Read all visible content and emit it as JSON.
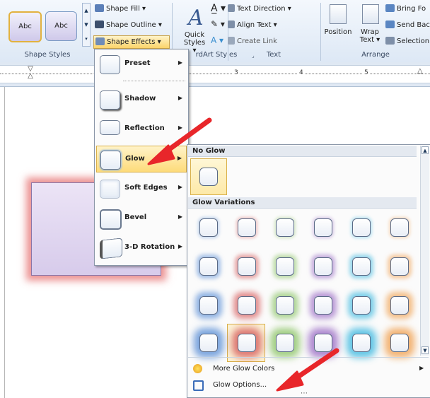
{
  "ribbon": {
    "shape_styles": {
      "group_label": "Shape Styles",
      "style1": "Abc",
      "style2": "Abc",
      "shape_fill": "Shape Fill ▾",
      "shape_outline": "Shape Outline ▾",
      "shape_effects": "Shape Effects ▾"
    },
    "wordart": {
      "group_label": "rdArt Styles",
      "quick_styles": "Quick Styles ▾"
    },
    "text": {
      "group_label": "Text",
      "text_direction": "Text Direction ▾",
      "align_text": "Align Text ▾",
      "create_link": "Create Link"
    },
    "arrange": {
      "group_label": "Arrange",
      "position": "Position",
      "wrap_text": "Wrap Text ▾",
      "bring_forward": "Bring Fo",
      "send_backward": "Send Bac",
      "selection": "Selection"
    }
  },
  "ruler": {
    "ticks": [
      "3",
      "4",
      "5"
    ]
  },
  "effects_menu": {
    "items": [
      {
        "label": "Preset",
        "accel": "P"
      },
      {
        "label": "Shadow",
        "accel": "S"
      },
      {
        "label": "Reflection",
        "accel": "R"
      },
      {
        "label": "Glow",
        "accel": "G"
      },
      {
        "label": "Soft Edges",
        "accel": "E"
      },
      {
        "label": "Bevel",
        "accel": "B"
      },
      {
        "label": "3-D Rotation",
        "accel": "D"
      }
    ]
  },
  "glow_menu": {
    "no_glow_header": "No Glow",
    "variations_header": "Glow Variations",
    "glow_colors": [
      "#5a8fd6",
      "#d65a5a",
      "#8cc466",
      "#9a6bc4",
      "#3cb8e0",
      "#f0a050"
    ],
    "more_colors": "More Glow Colors",
    "glow_options": "Glow Options...",
    "more_dots": "⋯"
  },
  "colors": {
    "highlight": "#fddb7a",
    "annotation_arrow": "#e8262a"
  }
}
